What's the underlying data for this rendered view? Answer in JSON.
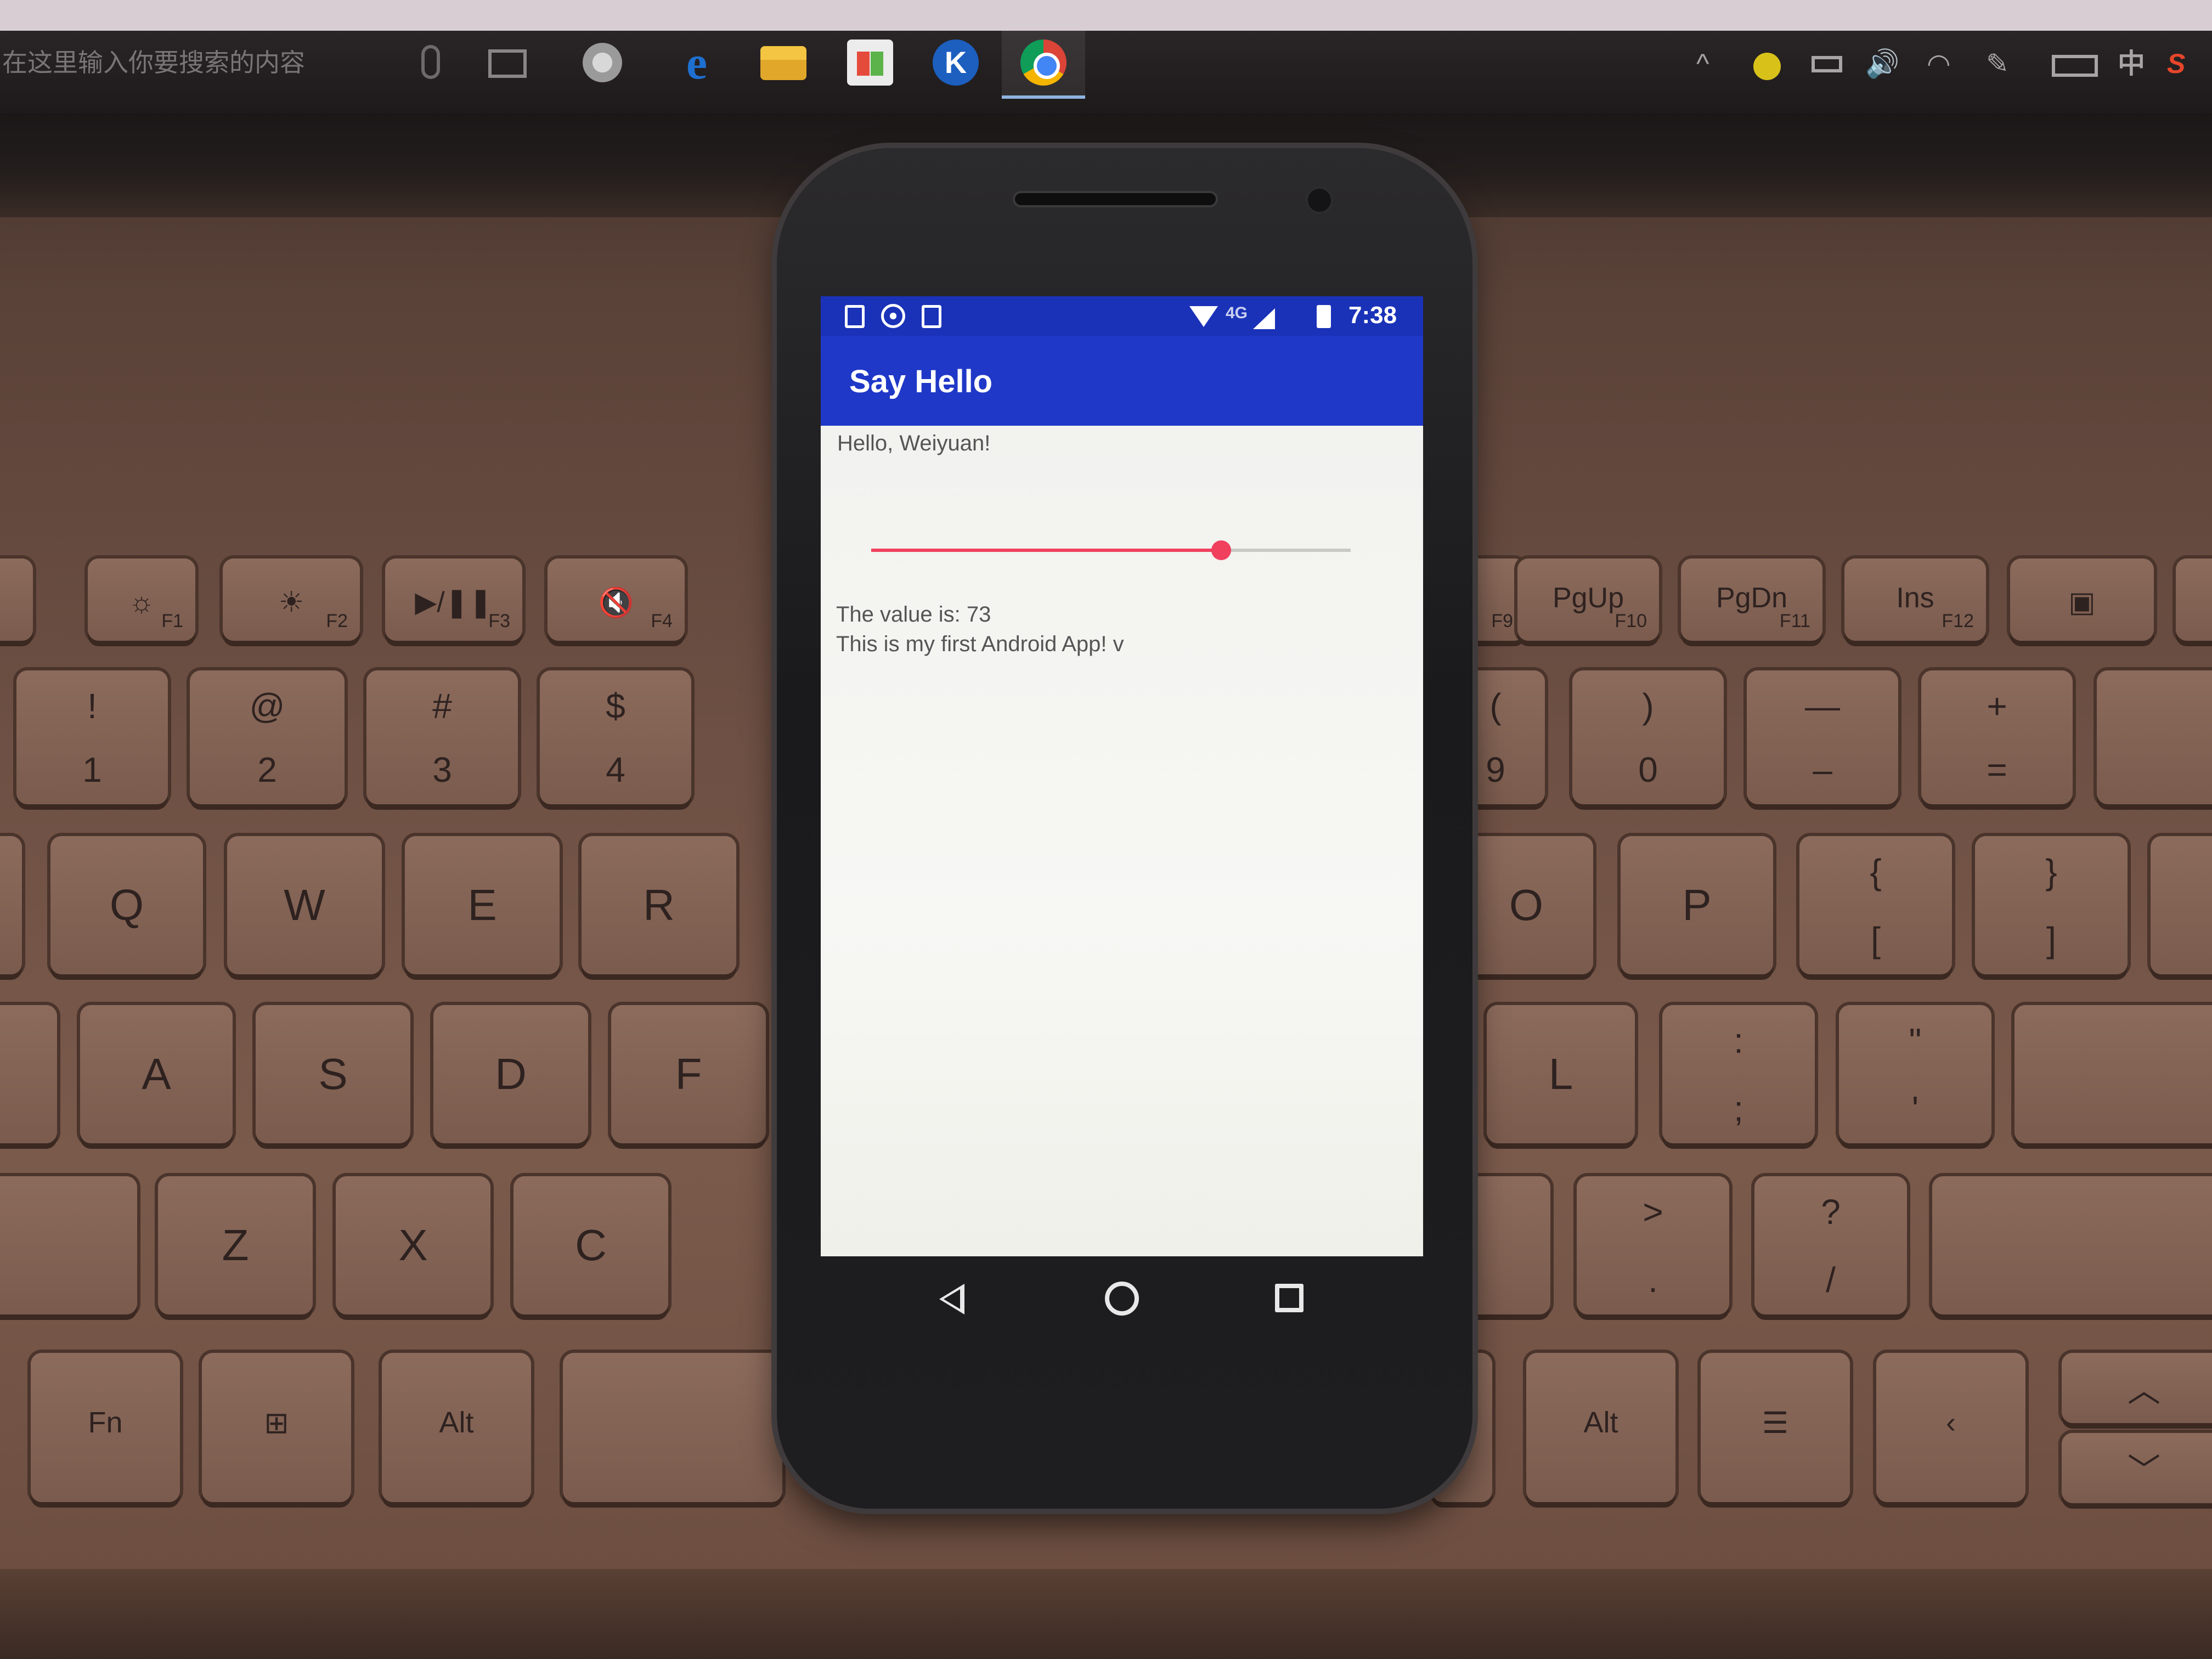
{
  "desktop": {
    "search_placeholder": "在这里输入你要搜索的内容",
    "taskbar_icons": [
      "mic-icon",
      "task-view-icon",
      "pinwheel-icon",
      "edge-icon",
      "file-explorer-icon",
      "store-icon",
      "k-app-icon",
      "chrome-icon"
    ],
    "tray": {
      "chevron": "^",
      "volume": "🔊",
      "wifi": "◠",
      "pen": "✎",
      "ime": "中",
      "app_s": "S"
    }
  },
  "keyboard": {
    "function_row": [
      {
        "glyph": "☼",
        "fn": "F1"
      },
      {
        "glyph": "☀",
        "fn": "F2"
      },
      {
        "glyph": "▶/❚❚",
        "fn": "F3"
      },
      {
        "glyph": "🔇",
        "fn": "F4"
      },
      {
        "glyph": "",
        "fn": "F9"
      },
      {
        "glyph": "PgUp",
        "fn": "F10"
      },
      {
        "glyph": "PgDn",
        "fn": "F11"
      },
      {
        "glyph": "Ins",
        "fn": "F12"
      }
    ],
    "number_row": [
      {
        "top": "!",
        "bot": "1"
      },
      {
        "top": "@",
        "bot": "2"
      },
      {
        "top": "#",
        "bot": "3"
      },
      {
        "top": "$",
        "bot": "4"
      },
      {
        "top": "(",
        "bot": "9"
      },
      {
        "top": ")",
        "bot": "0"
      },
      {
        "top": "—",
        "bot": "–"
      },
      {
        "top": "+",
        "bot": "="
      }
    ],
    "row_q": [
      "Q",
      "W",
      "E",
      "R",
      "O",
      "P"
    ],
    "row_q_brackets": [
      {
        "top": "{",
        "bot": "["
      },
      {
        "top": "}",
        "bot": "]"
      }
    ],
    "row_a": [
      "A",
      "S",
      "D",
      "F",
      "L"
    ],
    "row_a_punct": [
      {
        "top": ":",
        "bot": ";"
      },
      {
        "top": "\"",
        "bot": "'"
      }
    ],
    "row_z": [
      "Z",
      "X",
      "C"
    ],
    "row_z_punct": [
      {
        "top": ">",
        "bot": "."
      },
      {
        "top": "?",
        "bot": "/"
      }
    ],
    "bottom_row": [
      "Fn",
      "Alt",
      "Alt"
    ]
  },
  "phone": {
    "status_bar": {
      "network": "4G",
      "time": "7:38",
      "color": "#1a32b8"
    },
    "app_bar": {
      "title": "Say Hello",
      "color": "#1f38c7"
    },
    "content": {
      "greeting": "Hello, Weiyuan!",
      "seekbar": {
        "value": 73,
        "max": 100,
        "accent": "#f0405e"
      },
      "value_text": "The value is: 73",
      "message": "This is my first Android App! v"
    },
    "nav": [
      "back-icon",
      "home-icon",
      "recents-icon"
    ]
  }
}
